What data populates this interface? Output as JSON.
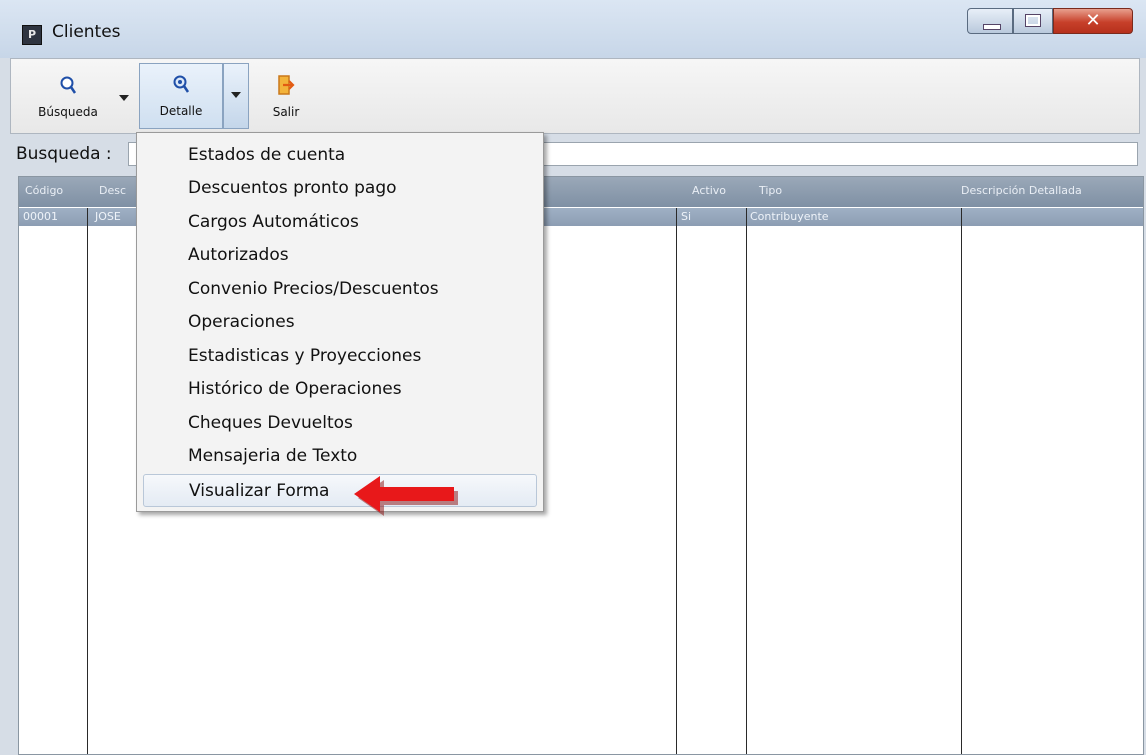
{
  "window": {
    "title": "Clientes",
    "app_icon_text": "P"
  },
  "toolbar": {
    "busqueda_label": "Búsqueda",
    "detalle_label": "Detalle",
    "salir_label": "Salir"
  },
  "search": {
    "label": "Busqueda :",
    "value": ""
  },
  "grid": {
    "headers": [
      "Código",
      "Desc",
      "Activo",
      "Tipo",
      "Descripción Detallada"
    ],
    "row": [
      "00001",
      "JOSE",
      "Si",
      "Contribuyente",
      ""
    ]
  },
  "menu": {
    "items": [
      "Estados de cuenta",
      "Descuentos pronto pago",
      "Cargos Automáticos",
      "Autorizados",
      "Convenio Precios/Descuentos",
      "Operaciones",
      "Estadisticas y Proyecciones",
      "Histórico de Operaciones",
      "Cheques Devueltos",
      "Mensajeria de Texto",
      "Visualizar Forma"
    ],
    "highlighted_index": 10
  },
  "colors": {
    "annotation_arrow": "#e8181a",
    "header_bg": "#8a9bb0"
  },
  "icons": [
    "app-icon",
    "magnifier-icon",
    "magnifier-detail-icon",
    "exit-icon",
    "chevron-down-icon"
  ]
}
